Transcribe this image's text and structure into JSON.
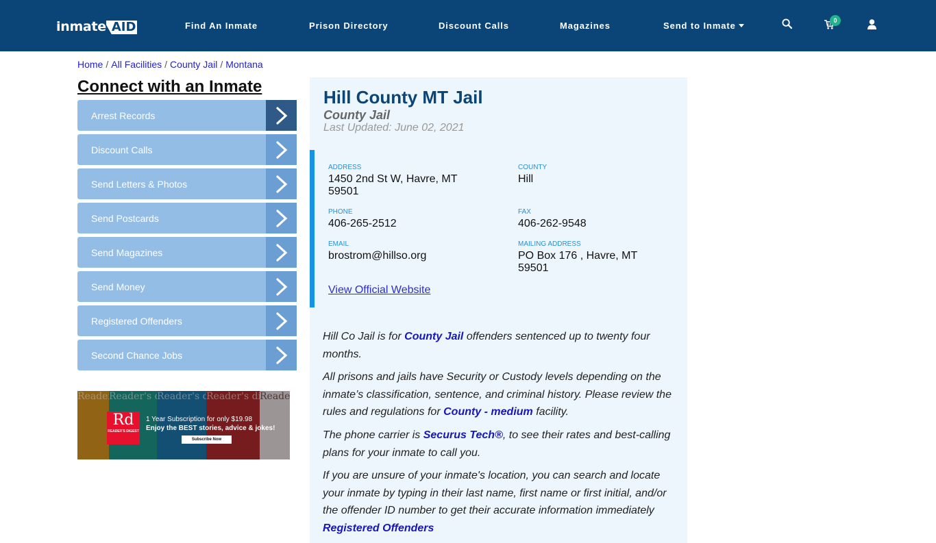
{
  "navbar": {
    "logo_text": "inmate",
    "logo_accent": "AID",
    "logo_plus": "+",
    "links": [
      "Find An Inmate",
      "Prison Directory",
      "Discount Calls",
      "Magazines",
      "Send to Inmate"
    ],
    "cart_count": "0",
    "icons": [
      "search-icon",
      "cart-icon",
      "user-icon"
    ],
    "background_color": "#0b4476"
  },
  "breadcrumb": {
    "items": [
      "Home",
      "All Facilities",
      "County Jail",
      "Montana"
    ],
    "separator": "/"
  },
  "sidebar": {
    "title": "Connect with an Inmate",
    "items": [
      {
        "label": "Arrest Records"
      },
      {
        "label": "Discount Calls"
      },
      {
        "label": "Send Letters & Photos"
      },
      {
        "label": "Send Postcards"
      },
      {
        "label": "Send Magazines"
      },
      {
        "label": "Send Money"
      },
      {
        "label": "Registered Offenders"
      },
      {
        "label": "Second Chance Jobs"
      }
    ],
    "ad": {
      "brand": "Rd",
      "brand_name": "READER'S DIGEST",
      "cover_title": "Reader's digest",
      "line1": "1 Year Subscription for only $19.98",
      "line2": "Enjoy the BEST stories, advice & jokes!",
      "button": "Subscribe Now"
    }
  },
  "facility": {
    "title": "Hill County MT Jail",
    "type": "County Jail",
    "last_updated": "Last Updated: June 02, 2021",
    "fields": {
      "address": {
        "label": "ADDRESS",
        "value": "1450 2nd St W, Havre, MT 59501"
      },
      "county": {
        "label": "COUNTY",
        "value": "Hill"
      },
      "phone": {
        "label": "PHONE",
        "value": "406-265-2512"
      },
      "fax": {
        "label": "FAX",
        "value": "406-262-9548"
      },
      "email": {
        "label": "EMAIL",
        "value": "brostrom@hillso.org"
      },
      "mailing": {
        "label": "MAILING ADDRESS",
        "value": "PO Box 176 , Havre, MT 59501"
      }
    },
    "website_link": "View Official Website"
  },
  "description": {
    "p1_before": "Hill Co Jail is for ",
    "p1_link": "County Jail",
    "p1_after": " offenders sentenced up to twenty four months.",
    "p2_before": "All prisons and jails have Security or Custody levels depending on the inmate’s classification, sentence, and criminal history. Please review the rules and regulations for ",
    "p2_link": "County - medium",
    "p2_after": " facility.",
    "p3_before": "The phone carrier is ",
    "p3_link": "Securus Tech®",
    "p3_after": ", to see their rates and best-calling plans for your inmate to call you.",
    "p4_text": "If you are unsure of your inmate's location, you can search and locate your inmate by typing in their last name, first name or first initial, and/or the offender ID number to get their accurate information immediately ",
    "p4_link": "Registered Offenders"
  }
}
